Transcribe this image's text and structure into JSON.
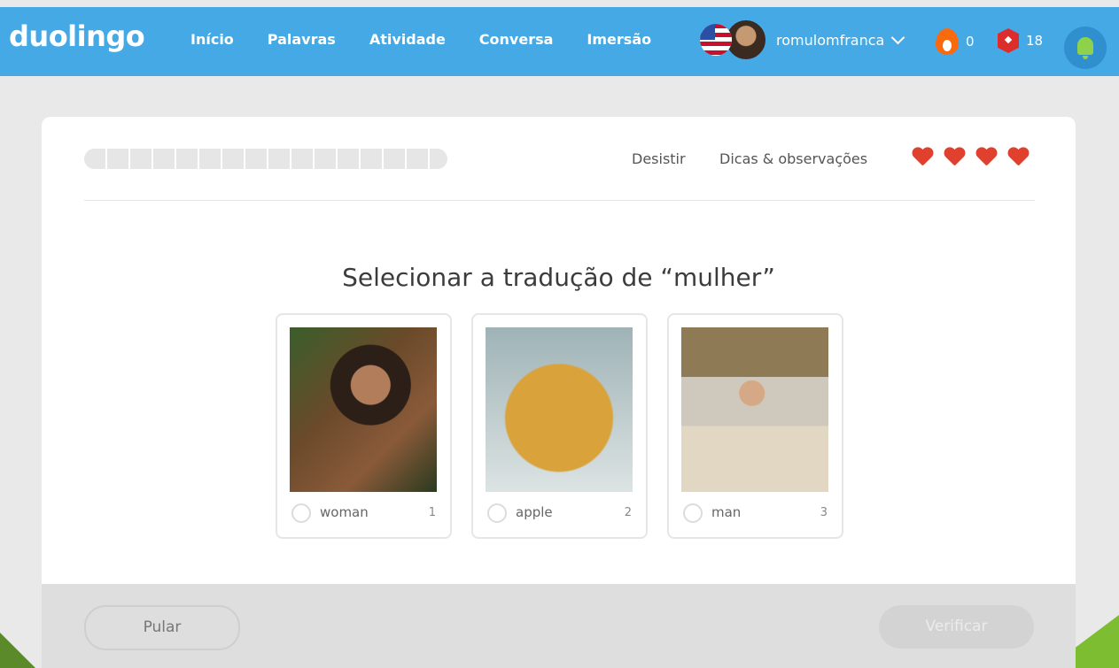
{
  "app": {
    "logo": "duolingo"
  },
  "nav": [
    {
      "label": "Início"
    },
    {
      "label": "Palavras"
    },
    {
      "label": "Atividade"
    },
    {
      "label": "Conversa"
    },
    {
      "label": "Imersão"
    }
  ],
  "user": {
    "name": "romulomfranca",
    "streak": "0",
    "gems": "18"
  },
  "lesson": {
    "progress_segments": 16,
    "progress_filled": 0,
    "quit_label": "Desistir",
    "tips_label": "Dicas & observações",
    "hearts": 4,
    "question": "Selecionar a tradução de “mulher”",
    "choices": [
      {
        "label": "woman",
        "number": "1",
        "icon": "woman-photo"
      },
      {
        "label": "apple",
        "number": "2",
        "icon": "apple-photo"
      },
      {
        "label": "man",
        "number": "3",
        "icon": "man-photo"
      }
    ],
    "skip_label": "Pular",
    "check_label": "Verificar"
  },
  "colors": {
    "topbar": "#45a9e6",
    "heart": "#e0412f",
    "streak": "#f96a0e",
    "gem": "#dd2c2c"
  }
}
